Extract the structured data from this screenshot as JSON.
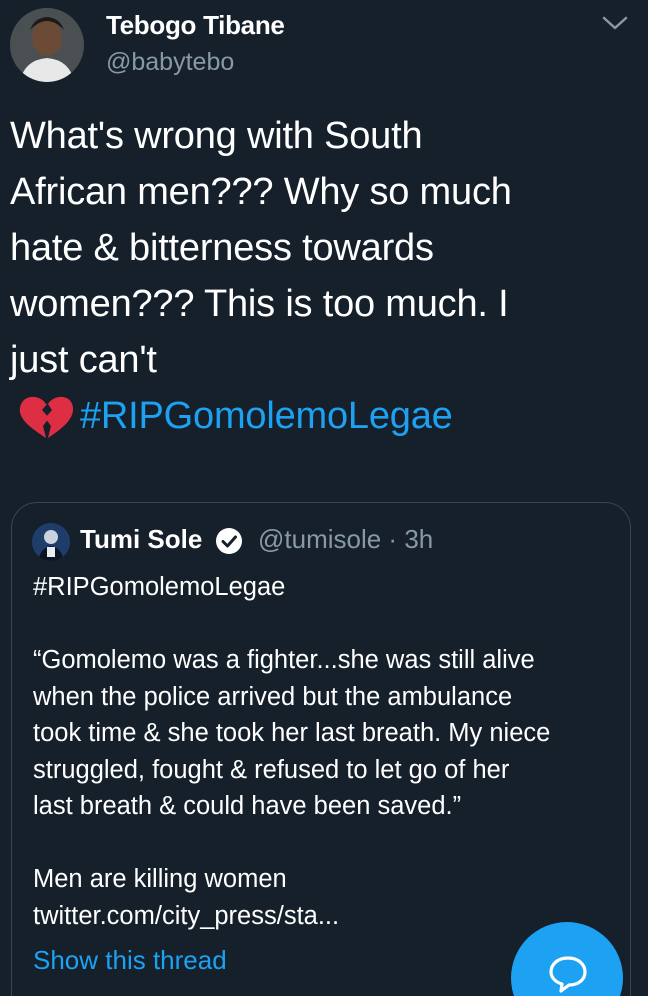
{
  "tweet": {
    "author": {
      "display_name": "Tebogo Tibane",
      "handle": "@babytebo"
    },
    "text_lines": [
      "What's wrong with South",
      "African men??? Why so much",
      "hate & bitterness towards",
      "women??? This is too much. I",
      "just can't"
    ],
    "emoji": "broken-heart",
    "hashtag": "#RIPGomolemoLegae"
  },
  "quoted_tweet": {
    "author": {
      "display_name": "Tumi Sole",
      "verified": true,
      "handle_time": "@tumisole · 3h"
    },
    "body_lines": [
      "#RIPGomolemoLegae",
      "",
      "“Gomolemo was a fighter...she was still alive",
      "when the police arrived but the ambulance",
      "took time & she took her last breath. My niece",
      "struggled, fought & refused to let go of her",
      "last breath & could have been saved.”",
      "",
      "Men are killing women",
      "twitter.com/city_press/sta..."
    ],
    "show_thread": "Show this thread"
  },
  "colors": {
    "background": "#15202b",
    "accent": "#1da1f2",
    "secondary_text": "#8899a6",
    "border": "#38444d"
  }
}
